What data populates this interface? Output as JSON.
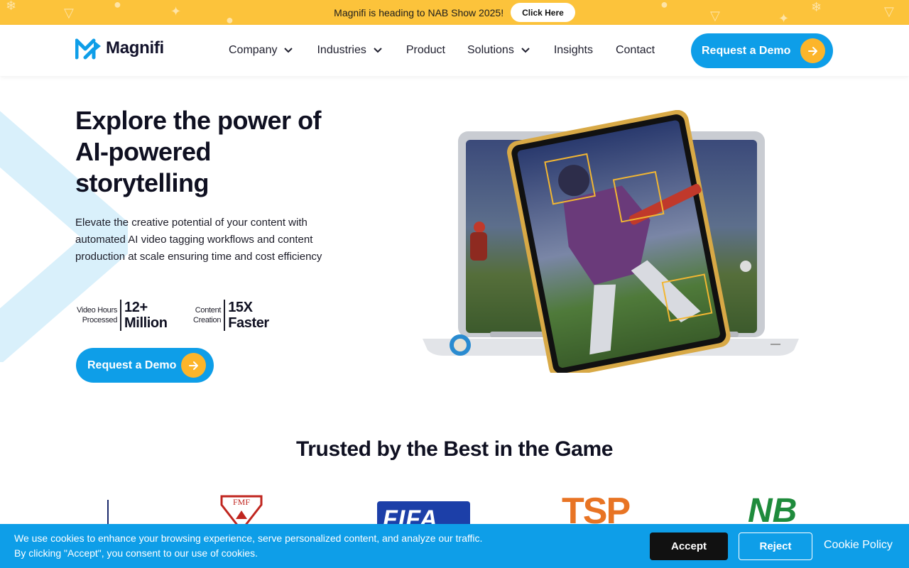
{
  "announcement": {
    "text": "Magnifi is heading to NAB Show 2025!",
    "button_label": "Click Here"
  },
  "brand": {
    "name": "Magnifi",
    "accent": "#0e9ee8",
    "yellow": "#fcc33b",
    "orange": "#fcb52a"
  },
  "nav": {
    "items": [
      {
        "label": "Company",
        "has_dropdown": true
      },
      {
        "label": "Industries",
        "has_dropdown": true
      },
      {
        "label": "Product",
        "has_dropdown": false
      },
      {
        "label": "Solutions",
        "has_dropdown": true
      },
      {
        "label": "Insights",
        "has_dropdown": false
      },
      {
        "label": "Contact",
        "has_dropdown": false
      }
    ],
    "cta_label": "Request a Demo"
  },
  "hero": {
    "title": "Explore the power of AI-powered storytelling",
    "description": "Elevate the creative potential of your content with automated AI video tagging workflows and content production at scale ensuring time and cost efficiency",
    "stats": [
      {
        "label_line1": "Video Hours",
        "label_line2": "Processed",
        "value_line1": "12+",
        "value_line2": "Million"
      },
      {
        "label_line1": "Content",
        "label_line2": "Creation",
        "value_line1": "15X",
        "value_line2": "Faster"
      }
    ],
    "cta_label": "Request a Demo"
  },
  "trusted": {
    "title": "Trusted by the Best in the Game",
    "logos": [
      "FMF",
      "FIFA",
      "TSP",
      "NB"
    ]
  },
  "cookie": {
    "line1": "We use cookies to enhance your browsing experience, serve personalized content, and analyze our traffic.",
    "line2": "By clicking \"Accept\", you consent to our use of cookies.",
    "accept_label": "Accept",
    "reject_label": "Reject",
    "policy_label": "Cookie Policy"
  }
}
